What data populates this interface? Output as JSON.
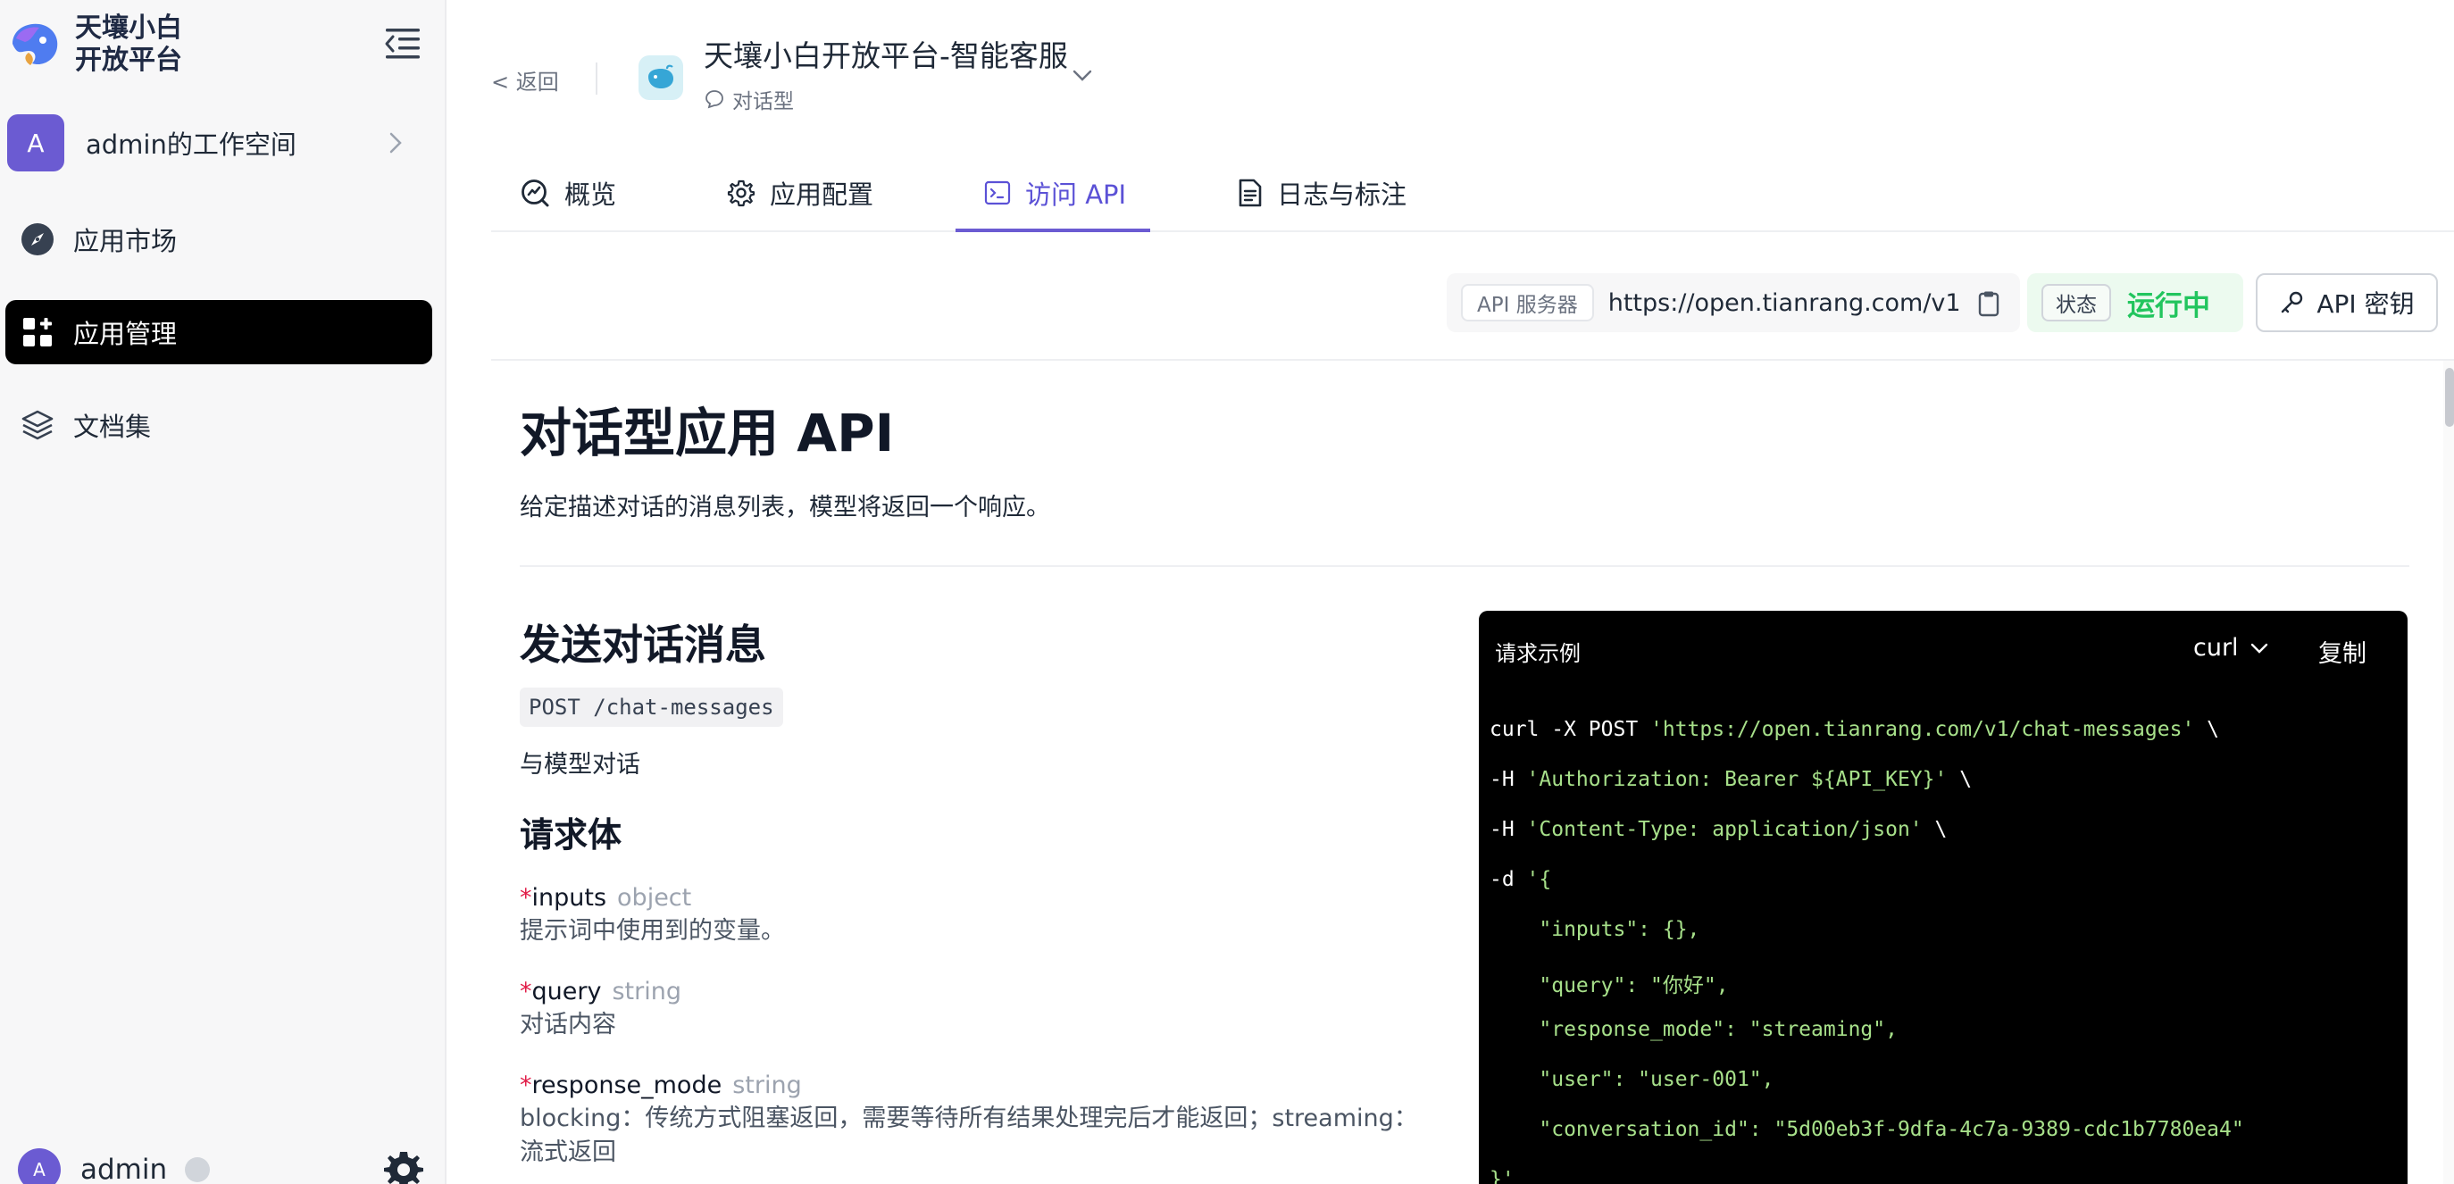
{
  "brand": {
    "line1": "天壤小白",
    "line2": "开放平台"
  },
  "workspace": {
    "avatar": "A",
    "name": "admin的工作空间"
  },
  "nav": [
    {
      "label": "应用市场",
      "icon": "compass-icon"
    },
    {
      "label": "应用管理",
      "icon": "grid-plus-icon",
      "active": true
    },
    {
      "label": "文档集",
      "icon": "layers-icon"
    }
  ],
  "user": {
    "avatar": "A",
    "name": "admin"
  },
  "header": {
    "back": "<  返回",
    "app_title": "天壤小白开放平台-智能客服",
    "app_type": "对话型"
  },
  "tabs": [
    {
      "label": "概览",
      "icon": "overview-icon"
    },
    {
      "label": "应用配置",
      "icon": "gear-icon"
    },
    {
      "label": "访问 API",
      "icon": "terminal-icon",
      "active": true
    },
    {
      "label": "日志与标注",
      "icon": "document-icon"
    }
  ],
  "server": {
    "tag": "API 服务器",
    "url": "https://open.tianrang.com/v1"
  },
  "status": {
    "tag": "状态",
    "value": "运行中"
  },
  "api_key_button": "API 密钥",
  "doc": {
    "title": "对话型应用 API",
    "desc": "给定描述对话的消息列表，模型将返回一个响应。",
    "section_title": "发送对话消息",
    "endpoint": "POST /chat-messages",
    "endpoint_desc": "与模型对话",
    "body_title": "请求体",
    "params": [
      {
        "req": "*",
        "name": "inputs",
        "type": "object",
        "desc": "提示词中使用到的变量。"
      },
      {
        "req": "*",
        "name": "query",
        "type": "string",
        "desc": "对话内容"
      },
      {
        "req": "*",
        "name": "response_mode",
        "type": "string",
        "desc": "blocking：传统方式阻塞返回，需要等待所有结果处理完后才能返回；streaming：",
        "desc2": "流式返回"
      }
    ]
  },
  "code": {
    "label": "请求示例",
    "lang": "curl",
    "copy": "复制",
    "lines": [
      {
        "a": "curl -X POST ",
        "b": "'https://open.tianrang.com/v1/chat-messages'",
        "c": " \\"
      },
      {
        "a": "-H ",
        "b": "'Authorization: Bearer ${API_KEY}'",
        "c": " \\"
      },
      {
        "a": "-H ",
        "b": "'Content-Type: application/json'",
        "c": " \\"
      },
      {
        "a": "-d ",
        "b": "'{",
        "c": ""
      },
      {
        "a": "",
        "b": "    \"inputs\": {},",
        "c": ""
      },
      {
        "a": "",
        "b": "    \"query\": \"你好\",",
        "c": ""
      },
      {
        "a": "",
        "b": "    \"response_mode\": \"streaming\",",
        "c": ""
      },
      {
        "a": "",
        "b": "    \"user\": \"user-001\",",
        "c": ""
      },
      {
        "a": "",
        "b": "    \"conversation_id\": \"5d00eb3f-9dfa-4c7a-9389-cdc1b7780ea4\"",
        "c": ""
      },
      {
        "a": "",
        "b": "}'",
        "c": ""
      }
    ]
  }
}
